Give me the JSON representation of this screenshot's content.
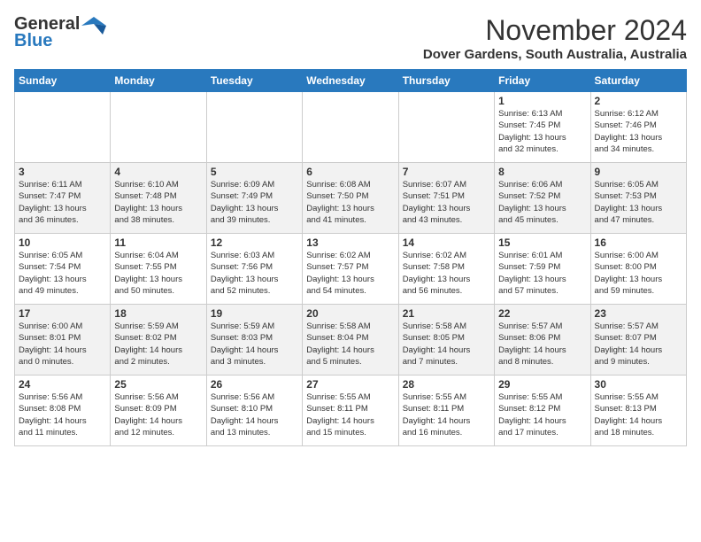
{
  "header": {
    "logo_general": "General",
    "logo_blue": "Blue",
    "month_year": "November 2024",
    "location": "Dover Gardens, South Australia, Australia"
  },
  "weekdays": [
    "Sunday",
    "Monday",
    "Tuesday",
    "Wednesday",
    "Thursday",
    "Friday",
    "Saturday"
  ],
  "weeks": [
    [
      {
        "day": "",
        "info": ""
      },
      {
        "day": "",
        "info": ""
      },
      {
        "day": "",
        "info": ""
      },
      {
        "day": "",
        "info": ""
      },
      {
        "day": "",
        "info": ""
      },
      {
        "day": "1",
        "info": "Sunrise: 6:13 AM\nSunset: 7:45 PM\nDaylight: 13 hours\nand 32 minutes."
      },
      {
        "day": "2",
        "info": "Sunrise: 6:12 AM\nSunset: 7:46 PM\nDaylight: 13 hours\nand 34 minutes."
      }
    ],
    [
      {
        "day": "3",
        "info": "Sunrise: 6:11 AM\nSunset: 7:47 PM\nDaylight: 13 hours\nand 36 minutes."
      },
      {
        "day": "4",
        "info": "Sunrise: 6:10 AM\nSunset: 7:48 PM\nDaylight: 13 hours\nand 38 minutes."
      },
      {
        "day": "5",
        "info": "Sunrise: 6:09 AM\nSunset: 7:49 PM\nDaylight: 13 hours\nand 39 minutes."
      },
      {
        "day": "6",
        "info": "Sunrise: 6:08 AM\nSunset: 7:50 PM\nDaylight: 13 hours\nand 41 minutes."
      },
      {
        "day": "7",
        "info": "Sunrise: 6:07 AM\nSunset: 7:51 PM\nDaylight: 13 hours\nand 43 minutes."
      },
      {
        "day": "8",
        "info": "Sunrise: 6:06 AM\nSunset: 7:52 PM\nDaylight: 13 hours\nand 45 minutes."
      },
      {
        "day": "9",
        "info": "Sunrise: 6:05 AM\nSunset: 7:53 PM\nDaylight: 13 hours\nand 47 minutes."
      }
    ],
    [
      {
        "day": "10",
        "info": "Sunrise: 6:05 AM\nSunset: 7:54 PM\nDaylight: 13 hours\nand 49 minutes."
      },
      {
        "day": "11",
        "info": "Sunrise: 6:04 AM\nSunset: 7:55 PM\nDaylight: 13 hours\nand 50 minutes."
      },
      {
        "day": "12",
        "info": "Sunrise: 6:03 AM\nSunset: 7:56 PM\nDaylight: 13 hours\nand 52 minutes."
      },
      {
        "day": "13",
        "info": "Sunrise: 6:02 AM\nSunset: 7:57 PM\nDaylight: 13 hours\nand 54 minutes."
      },
      {
        "day": "14",
        "info": "Sunrise: 6:02 AM\nSunset: 7:58 PM\nDaylight: 13 hours\nand 56 minutes."
      },
      {
        "day": "15",
        "info": "Sunrise: 6:01 AM\nSunset: 7:59 PM\nDaylight: 13 hours\nand 57 minutes."
      },
      {
        "day": "16",
        "info": "Sunrise: 6:00 AM\nSunset: 8:00 PM\nDaylight: 13 hours\nand 59 minutes."
      }
    ],
    [
      {
        "day": "17",
        "info": "Sunrise: 6:00 AM\nSunset: 8:01 PM\nDaylight: 14 hours\nand 0 minutes."
      },
      {
        "day": "18",
        "info": "Sunrise: 5:59 AM\nSunset: 8:02 PM\nDaylight: 14 hours\nand 2 minutes."
      },
      {
        "day": "19",
        "info": "Sunrise: 5:59 AM\nSunset: 8:03 PM\nDaylight: 14 hours\nand 3 minutes."
      },
      {
        "day": "20",
        "info": "Sunrise: 5:58 AM\nSunset: 8:04 PM\nDaylight: 14 hours\nand 5 minutes."
      },
      {
        "day": "21",
        "info": "Sunrise: 5:58 AM\nSunset: 8:05 PM\nDaylight: 14 hours\nand 7 minutes."
      },
      {
        "day": "22",
        "info": "Sunrise: 5:57 AM\nSunset: 8:06 PM\nDaylight: 14 hours\nand 8 minutes."
      },
      {
        "day": "23",
        "info": "Sunrise: 5:57 AM\nSunset: 8:07 PM\nDaylight: 14 hours\nand 9 minutes."
      }
    ],
    [
      {
        "day": "24",
        "info": "Sunrise: 5:56 AM\nSunset: 8:08 PM\nDaylight: 14 hours\nand 11 minutes."
      },
      {
        "day": "25",
        "info": "Sunrise: 5:56 AM\nSunset: 8:09 PM\nDaylight: 14 hours\nand 12 minutes."
      },
      {
        "day": "26",
        "info": "Sunrise: 5:56 AM\nSunset: 8:10 PM\nDaylight: 14 hours\nand 13 minutes."
      },
      {
        "day": "27",
        "info": "Sunrise: 5:55 AM\nSunset: 8:11 PM\nDaylight: 14 hours\nand 15 minutes."
      },
      {
        "day": "28",
        "info": "Sunrise: 5:55 AM\nSunset: 8:11 PM\nDaylight: 14 hours\nand 16 minutes."
      },
      {
        "day": "29",
        "info": "Sunrise: 5:55 AM\nSunset: 8:12 PM\nDaylight: 14 hours\nand 17 minutes."
      },
      {
        "day": "30",
        "info": "Sunrise: 5:55 AM\nSunset: 8:13 PM\nDaylight: 14 hours\nand 18 minutes."
      }
    ]
  ]
}
